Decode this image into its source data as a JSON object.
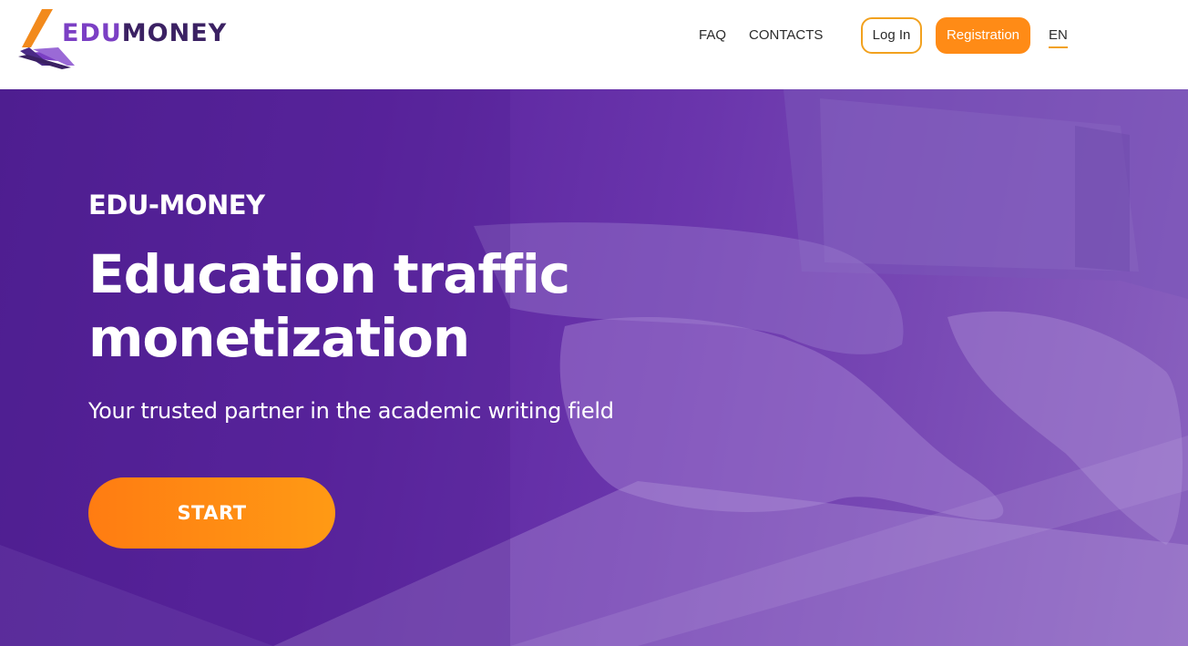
{
  "colors": {
    "brand_purple": "#5b259f",
    "accent_orange": "#ff8b16",
    "outline_orange": "#f2a11e",
    "text_dark": "#2b2b2b"
  },
  "header": {
    "logo": {
      "icon": "book-logo-icon",
      "text_edu": "EDU",
      "text_money": "MONEY"
    },
    "nav": {
      "faq_label": "FAQ",
      "contacts_label": "CONTACTS"
    },
    "login_label": "Log In",
    "register_label": "Registration",
    "language": "EN"
  },
  "hero": {
    "eyebrow": "EDU-MONEY",
    "title_line1": "Education traffic",
    "title_line2": "monetization",
    "subtitle": "Your trusted partner in the academic writing field",
    "cta_label": "START"
  }
}
